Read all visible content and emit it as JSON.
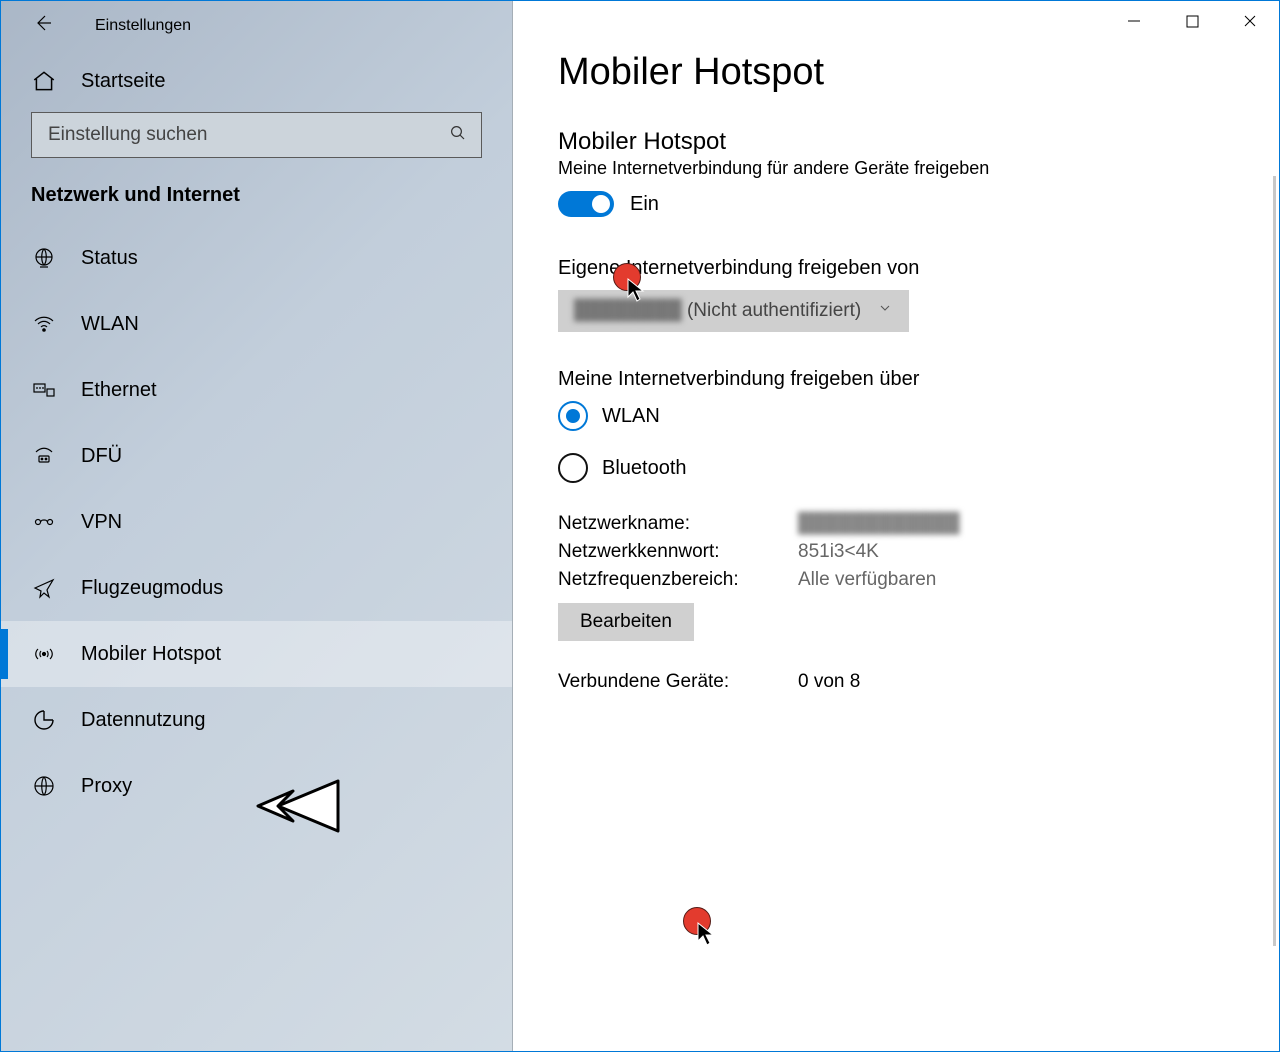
{
  "appTitle": "Einstellungen",
  "home": "Startseite",
  "searchPlaceholder": "Einstellung suchen",
  "category": "Netzwerk und Internet",
  "nav": {
    "status": "Status",
    "wlan": "WLAN",
    "ethernet": "Ethernet",
    "dfu": "DFÜ",
    "vpn": "VPN",
    "airplane": "Flugzeugmodus",
    "hotspot": "Mobiler Hotspot",
    "data": "Datennutzung",
    "proxy": "Proxy"
  },
  "main": {
    "pageTitle": "Mobiler Hotspot",
    "sectionTitle": "Mobiler Hotspot",
    "sectionSub": "Meine Internetverbindung für andere Geräte freigeben",
    "toggleLabel": "Ein",
    "shareFromLabel": "Eigene Internetverbindung freigeben von",
    "shareFromBlur": "████████",
    "shareFromValue": "(Nicht authentifiziert)",
    "shareOverLabel": "Meine Internetverbindung freigeben über",
    "radioWlan": "WLAN",
    "radioBluetooth": "Bluetooth",
    "netNameLabel": "Netzwerkname:",
    "netNameValue": "████████████",
    "netPassLabel": "Netzwerkkennwort:",
    "netPassValue": "851i3<4K",
    "netFreqLabel": "Netzfrequenzbereich:",
    "netFreqValue": "Alle verfügbaren",
    "editButton": "Bearbeiten",
    "connectedLabel": "Verbundene Geräte:",
    "connectedValue": "0 von 8"
  },
  "colors": {
    "accent": "#0078d7"
  }
}
